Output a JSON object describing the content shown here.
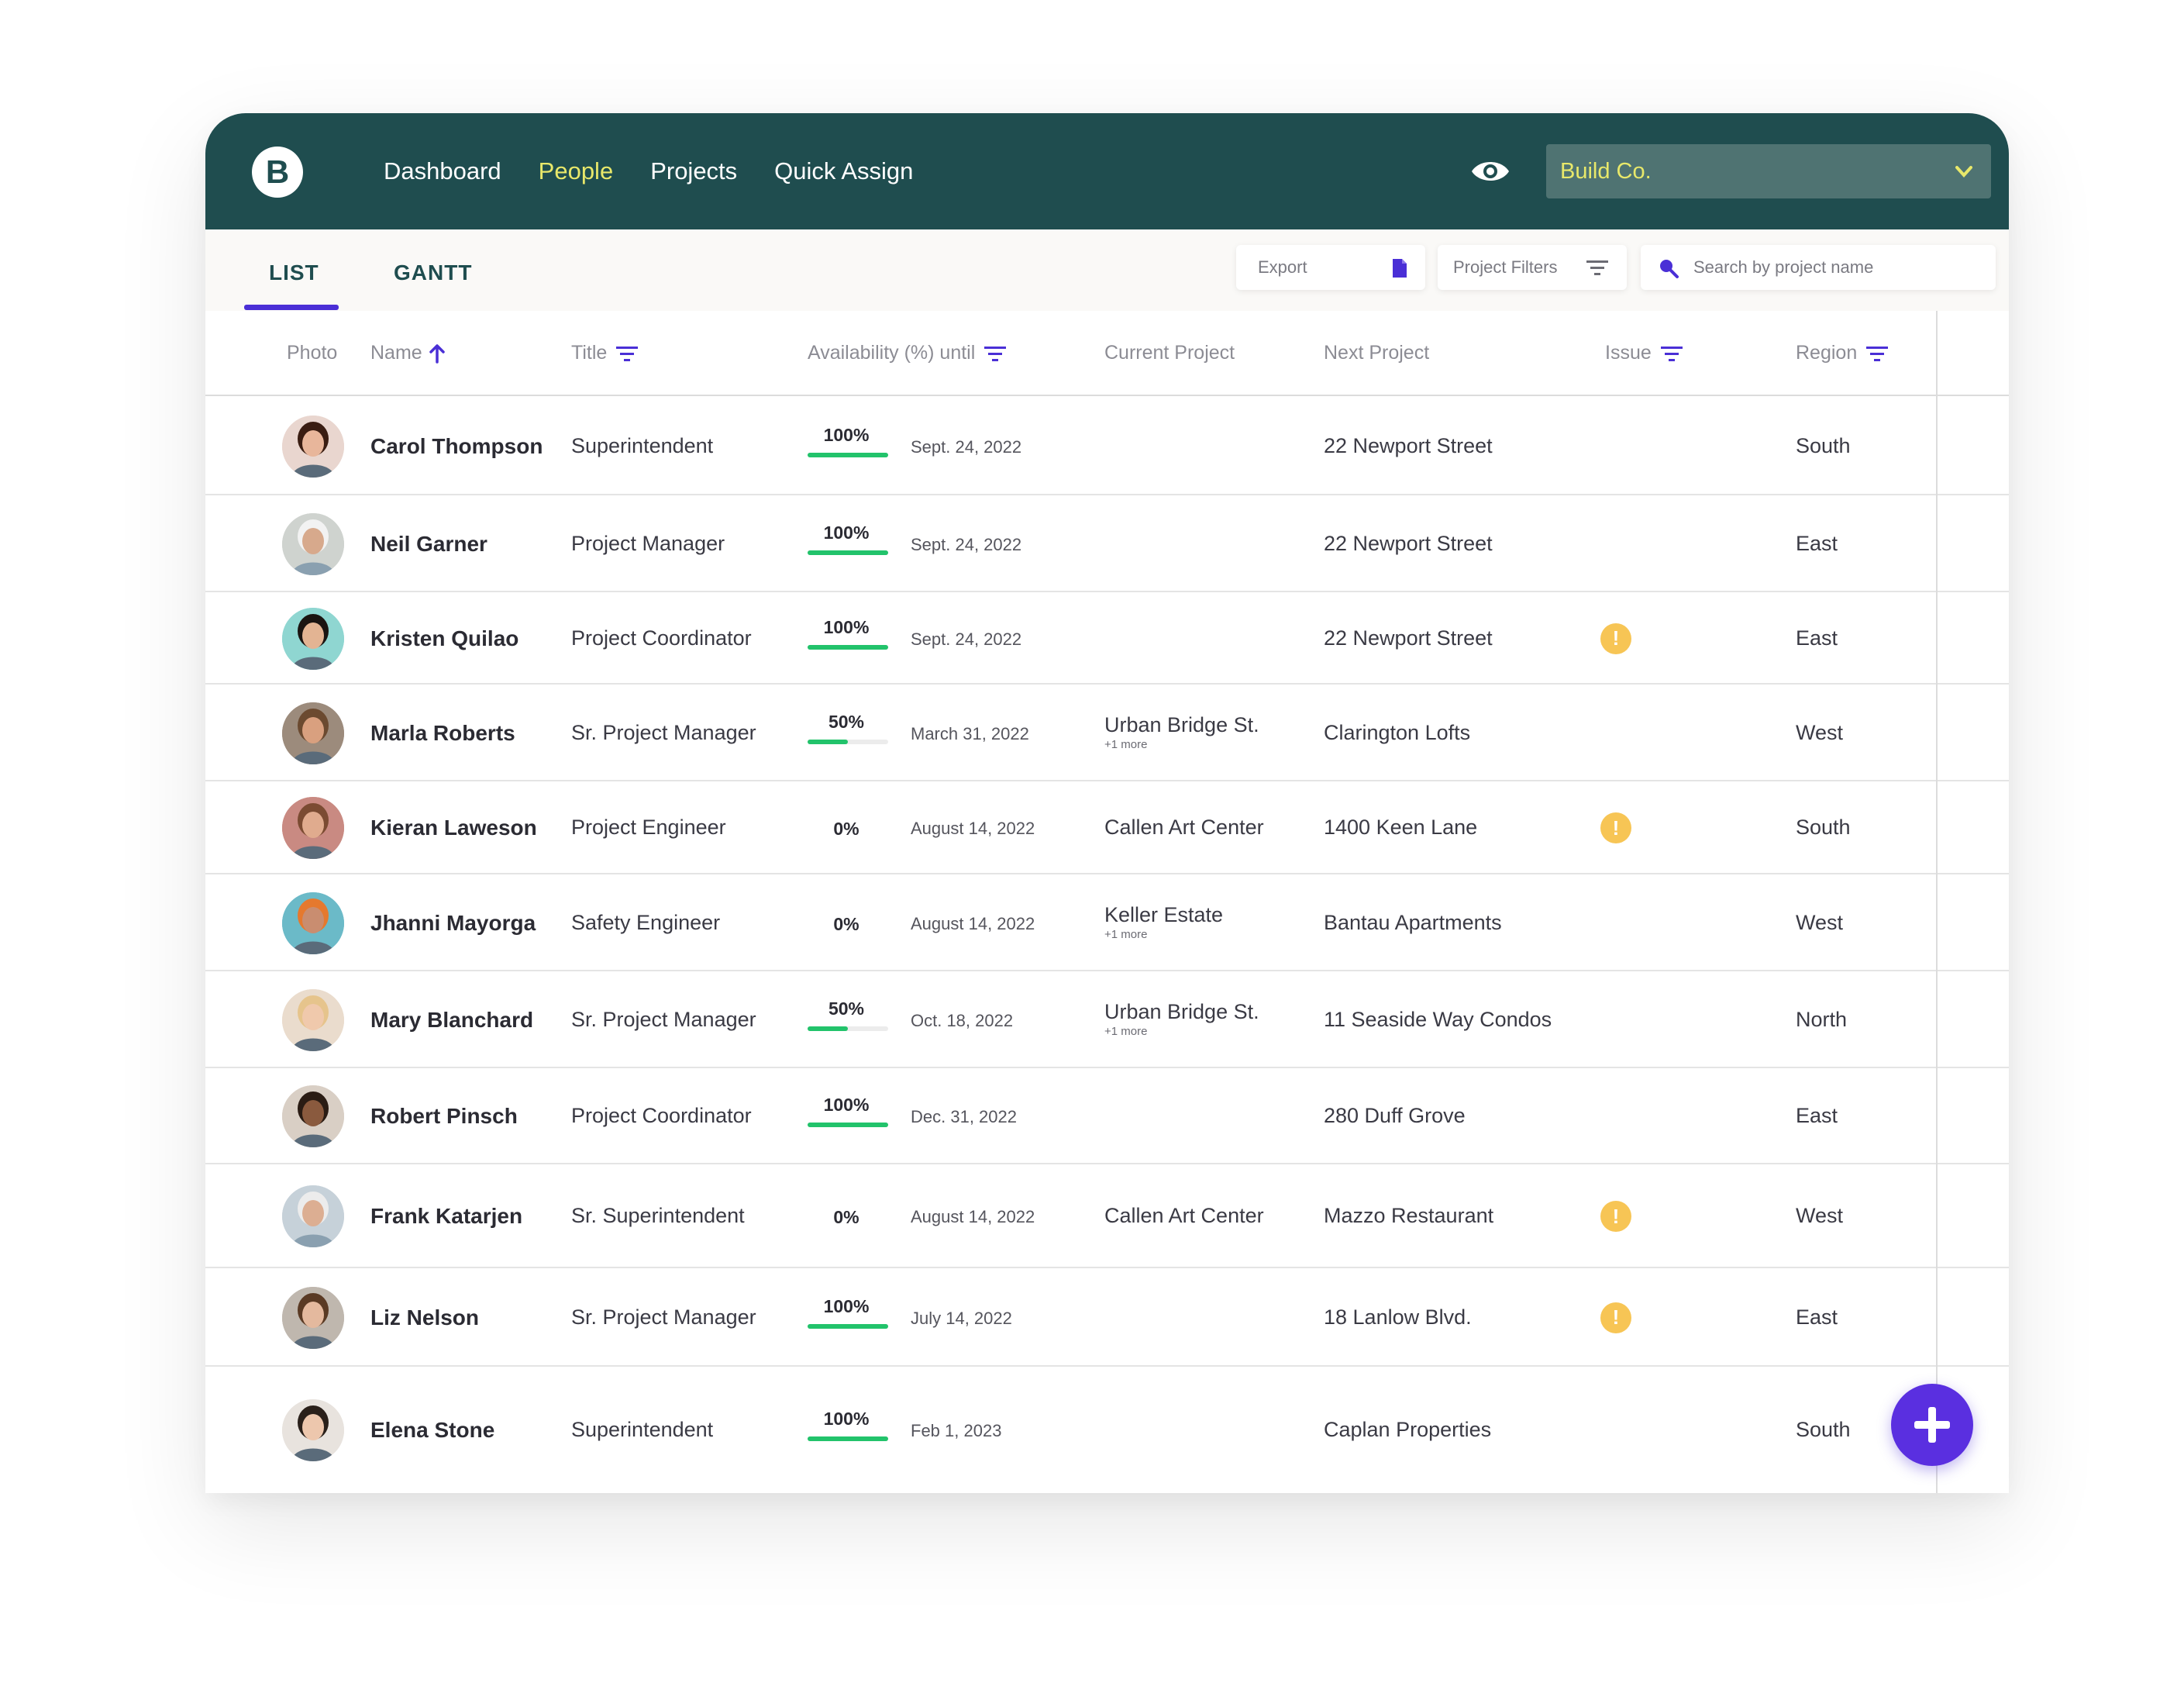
{
  "brand": {
    "logo_letter": "B"
  },
  "nav": [
    {
      "label": "Dashboard",
      "active": false
    },
    {
      "label": "People",
      "active": true
    },
    {
      "label": "Projects",
      "active": false
    },
    {
      "label": "Quick Assign",
      "active": false
    }
  ],
  "header_icons": [
    "eye-icon",
    "moon-icon",
    "help-icon",
    "user-icon"
  ],
  "company_select": {
    "value": "Build Co."
  },
  "tabs": [
    {
      "label": "LIST",
      "active": true
    },
    {
      "label": "GANTT",
      "active": false
    }
  ],
  "toolbar": {
    "export_label": "Export",
    "filters_label": "Project Filters",
    "search_placeholder": "Search by project name"
  },
  "columns": {
    "photo": "Photo",
    "name": "Name",
    "title": "Title",
    "availability": "Availability (%) until",
    "current_project": "Current Project",
    "next_project": "Next Project",
    "issue": "Issue",
    "region": "Region"
  },
  "rows": [
    {
      "name": "Carol Thompson",
      "title": "Superintendent",
      "availability": "100%",
      "availability_fraction": 1.0,
      "until": "Sept. 24, 2022",
      "current_project": "",
      "current_more": "",
      "next_project": "22 Newport Street",
      "issue": false,
      "region": "South"
    },
    {
      "name": "Neil Garner",
      "title": "Project Manager",
      "availability": "100%",
      "availability_fraction": 1.0,
      "until": "Sept. 24, 2022",
      "current_project": "",
      "current_more": "",
      "next_project": "22 Newport Street",
      "issue": false,
      "region": "East"
    },
    {
      "name": "Kristen Quilao",
      "title": "Project Coordinator",
      "availability": "100%",
      "availability_fraction": 1.0,
      "until": "Sept. 24, 2022",
      "current_project": "",
      "current_more": "",
      "next_project": "22 Newport Street",
      "issue": true,
      "region": "East"
    },
    {
      "name": "Marla Roberts",
      "title": "Sr. Project Manager",
      "availability": "50%",
      "availability_fraction": 0.5,
      "until": "March 31, 2022",
      "current_project": "Urban Bridge St.",
      "current_more": "+1 more",
      "next_project": "Clarington Lofts",
      "issue": false,
      "region": "West"
    },
    {
      "name": "Kieran Laweson",
      "title": "Project Engineer",
      "availability": "0%",
      "availability_fraction": 0,
      "until": "August 14, 2022",
      "current_project": "Callen Art Center",
      "current_more": "",
      "next_project": "1400 Keen Lane",
      "issue": true,
      "region": "South"
    },
    {
      "name": "Jhanni Mayorga",
      "title": "Safety Engineer",
      "availability": "0%",
      "availability_fraction": 0,
      "until": "August 14, 2022",
      "current_project": "Keller Estate",
      "current_more": "+1 more",
      "next_project": "Bantau Apartments",
      "issue": false,
      "region": "West"
    },
    {
      "name": "Mary Blanchard",
      "title": "Sr. Project Manager",
      "availability": "50%",
      "availability_fraction": 0.5,
      "until": "Oct. 18, 2022",
      "current_project": "Urban Bridge St.",
      "current_more": "+1 more",
      "next_project": "11 Seaside Way Condos",
      "issue": false,
      "region": "North"
    },
    {
      "name": "Robert Pinsch",
      "title": "Project Coordinator",
      "availability": "100%",
      "availability_fraction": 1.0,
      "until": "Dec. 31, 2022",
      "current_project": "",
      "current_more": "",
      "next_project": "280 Duff Grove",
      "issue": false,
      "region": "East"
    },
    {
      "name": "Frank Katarjen",
      "title": "Sr. Superintendent",
      "availability": "0%",
      "availability_fraction": 0,
      "until": "August 14, 2022",
      "current_project": "Callen Art Center",
      "current_more": "",
      "next_project": "Mazzo Restaurant",
      "issue": true,
      "region": "West"
    },
    {
      "name": "Liz Nelson",
      "title": "Sr. Project Manager",
      "availability": "100%",
      "availability_fraction": 1.0,
      "until": "July 14, 2022",
      "current_project": "",
      "current_more": "",
      "next_project": "18 Lanlow Blvd.",
      "issue": true,
      "region": "East"
    },
    {
      "name": "Elena Stone",
      "title": "Superintendent",
      "availability": "100%",
      "availability_fraction": 1.0,
      "until": "Feb 1, 2023",
      "current_project": "",
      "current_more": "",
      "next_project": "Caplan Properties",
      "issue": false,
      "region": "South"
    }
  ],
  "issue_symbol": "!",
  "colors": {
    "header_bg": "#1f4d4f",
    "nav_active": "#e8e86a",
    "accent": "#4a2fd6",
    "availability_bar": "#22c36b",
    "issue_badge": "#f7c555",
    "fab": "#5a2fe0"
  }
}
